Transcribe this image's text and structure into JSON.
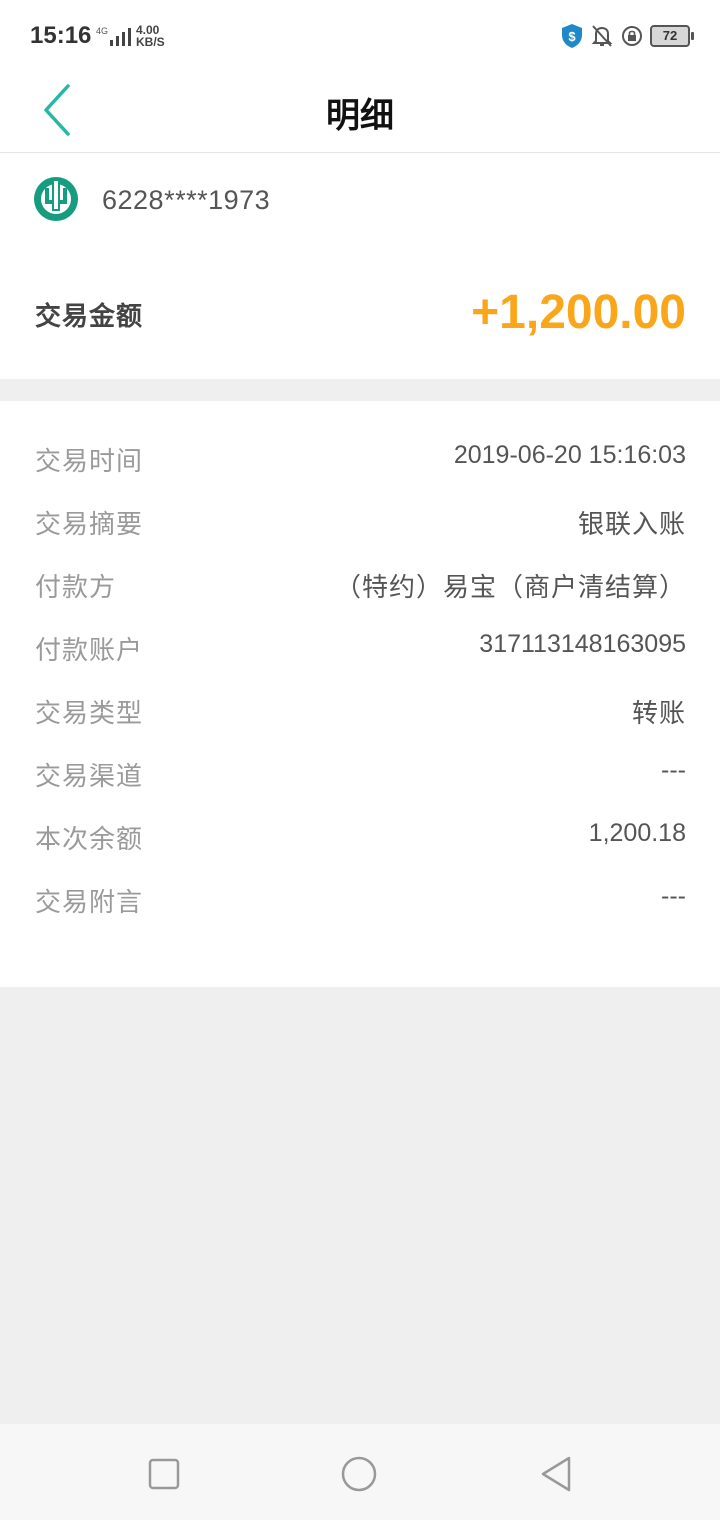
{
  "status_bar": {
    "time": "15:16",
    "network": "4G",
    "speed_value": "4.00",
    "speed_unit": "KB/S",
    "battery": "72"
  },
  "header": {
    "title": "明细",
    "back_icon": "chevron-left-icon"
  },
  "card": {
    "bank_logo": "abc-bank-logo",
    "number": "6228****1973"
  },
  "amount": {
    "label": "交易金额",
    "value": "+1,200.00",
    "color": "#f9a61a"
  },
  "details": [
    {
      "label": "交易时间",
      "value": "2019-06-20 15:16:03"
    },
    {
      "label": "交易摘要",
      "value": "银联入账"
    },
    {
      "label": "付款方",
      "value": "（特约）易宝（商户清结算）"
    },
    {
      "label": "付款账户",
      "value": "317113148163095"
    },
    {
      "label": "交易类型",
      "value": "转账"
    },
    {
      "label": "交易渠道",
      "value": "---"
    },
    {
      "label": "本次余额",
      "value": "1,200.18"
    },
    {
      "label": "交易附言",
      "value": "---"
    }
  ],
  "system_nav": {
    "recents_icon": "square-icon",
    "home_icon": "circle-icon",
    "back_icon": "triangle-back-icon"
  },
  "colors": {
    "accent": "#26b7a5",
    "amount": "#f9a61a"
  }
}
